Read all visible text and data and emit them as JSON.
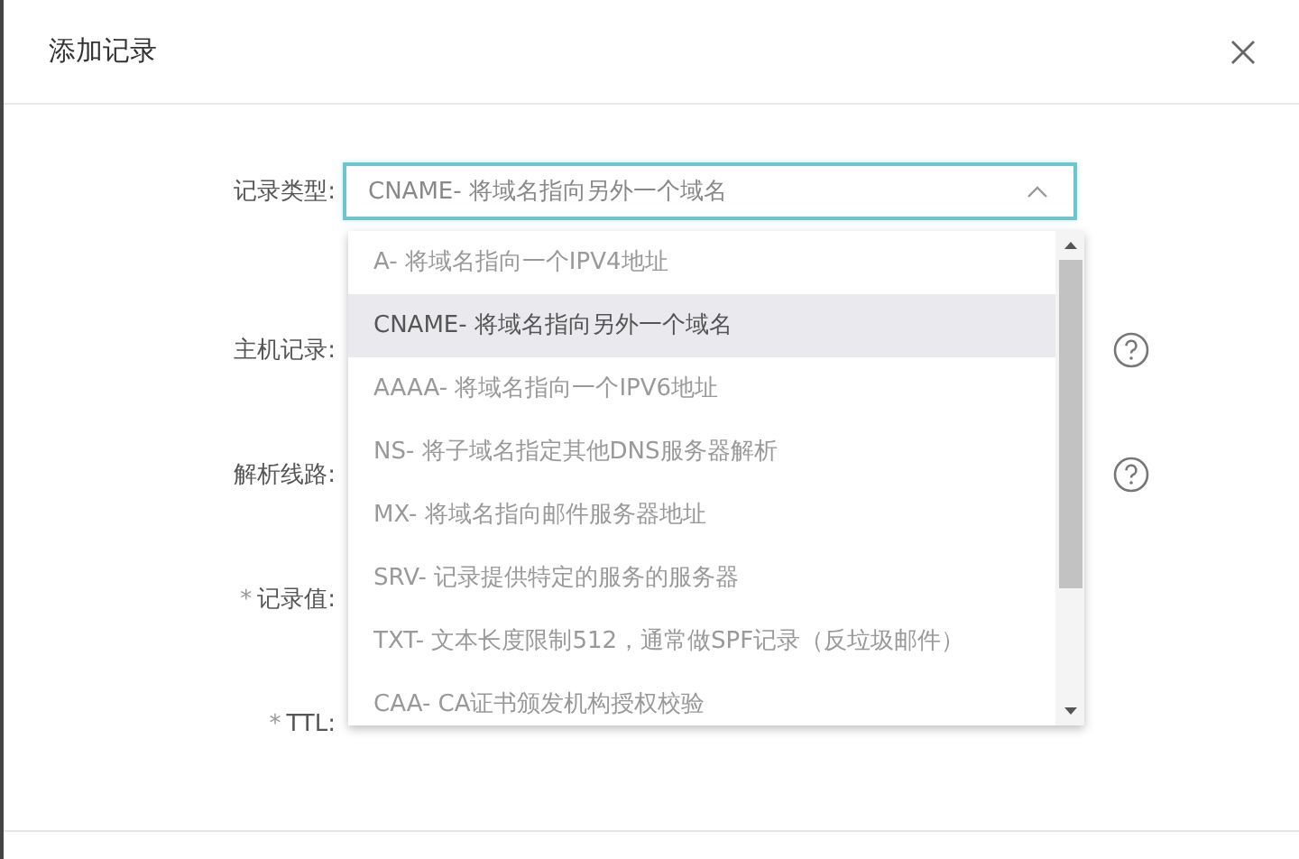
{
  "dialog": {
    "title": "添加记录"
  },
  "form": {
    "rows": [
      {
        "label": "记录类型:",
        "kind": "select",
        "value": "CNAME- 将域名指向另外一个域名",
        "expanded": true
      },
      {
        "label": "主机记录:",
        "kind": "field",
        "help": true
      },
      {
        "label": "解析线路:",
        "kind": "field",
        "help": true
      },
      {
        "label": "记录值:",
        "kind": "field",
        "required_mark": "*"
      },
      {
        "label": "TTL:",
        "kind": "field",
        "required_mark": "*"
      }
    ]
  },
  "dropdown": {
    "options": [
      {
        "text": "A- 将域名指向一个IPV4地址",
        "selected": false
      },
      {
        "text": "CNAME- 将域名指向另外一个域名",
        "selected": true
      },
      {
        "text": "AAAA- 将域名指向一个IPV6地址",
        "selected": false
      },
      {
        "text": "NS- 将子域名指定其他DNS服务器解析",
        "selected": false
      },
      {
        "text": "MX- 将域名指向邮件服务器地址",
        "selected": false
      },
      {
        "text": "SRV- 记录提供特定的服务的服务器",
        "selected": false
      },
      {
        "text": "TXT- 文本长度限制512，通常做SPF记录（反垃圾邮件）",
        "selected": false
      },
      {
        "text": "CAA- CA证书颁发机构授权校验",
        "selected": false
      }
    ]
  }
}
